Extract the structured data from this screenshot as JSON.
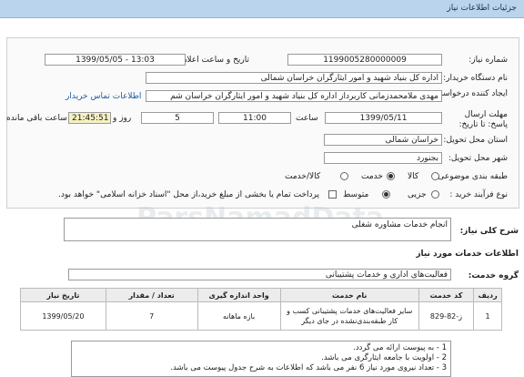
{
  "header": {
    "title": "جزئیات اطلاعات نیاز"
  },
  "need_number": {
    "label": "شماره نیاز:",
    "value": "1199005280000009"
  },
  "announce_date": {
    "label": "تاریخ و ساعت اعلان عمومی:",
    "value": "1399/05/05 - 13:03"
  },
  "buyer_org": {
    "label": "نام دستگاه خریدار:",
    "value": "اداره کل بنیاد شهید و امور ایثارگران خراسان شمالی"
  },
  "creator": {
    "label": "ایجاد کننده درخواست:",
    "value": "مهدی  ملامحمدزمانی کاربرداز اداره کل بنیاد شهید و امور ایثارگران خراسان شم",
    "contact_link": "اطلاعات تماس خریدار"
  },
  "deadline": {
    "label": "مهلت ارسال پاسخ: تا تاریخ:",
    "date": "1399/05/11",
    "time_label": "ساعت",
    "time": "11:00",
    "days": "5",
    "day_label": "روز و",
    "remaining": "21:45:51",
    "remaining_label": "ساعت باقی مانده"
  },
  "province": {
    "label": "استان محل تحویل:",
    "value": "خراسان شمالی"
  },
  "city": {
    "label": "شهر محل تحویل:",
    "value": "بجنورد"
  },
  "category": {
    "label": "طبقه بندی موضوعی:",
    "options": [
      "کالا",
      "خدمت",
      "کالا/خدمت"
    ],
    "selected": "خدمت"
  },
  "process": {
    "label": "نوع فرآیند خرید :",
    "options": [
      "جزیی",
      "متوسط"
    ],
    "selected": "متوسط",
    "payment_note": "پرداخت تمام یا بخشی از مبلغ خرید،از محل \"اسناد خزانه اسلامی\" خواهد بود."
  },
  "summary": {
    "label": "شرح کلی نیاز:",
    "value": "انجام خدمات مشاوره شغلی"
  },
  "services_info": {
    "title": "اطلاعات خدمات مورد نیاز"
  },
  "service_group": {
    "label": "گروه خدمت:",
    "value": "فعالیت‌های اداری و خدمات پشتیبانی"
  },
  "table": {
    "headers": [
      "ردیف",
      "کد خدمت",
      "نام خدمت",
      "واحد اندازه گیری",
      "تعداد / مقدار",
      "تاریخ نیاز"
    ],
    "rows": [
      {
        "row": "1",
        "code": "ز-82-829",
        "name": "سایر فعالیت‌های خدمات پشتیبانی کسب و کار طبقه‌بندی‌نشده در جای دیگر",
        "unit": "بازه ماهانه",
        "qty": "7",
        "date": "1399/05/20"
      }
    ]
  },
  "notes": [
    "1 - به پیوست ارائه می گردد.",
    "2 - اولویت با جامعه ایثارگری می باشد.",
    "3 - تعداد نیروی مورد نیاز 6 نفر می باشد که اطلاعات به شرح جدول پیوست می باشد."
  ],
  "watermark": "ParsNamadData"
}
